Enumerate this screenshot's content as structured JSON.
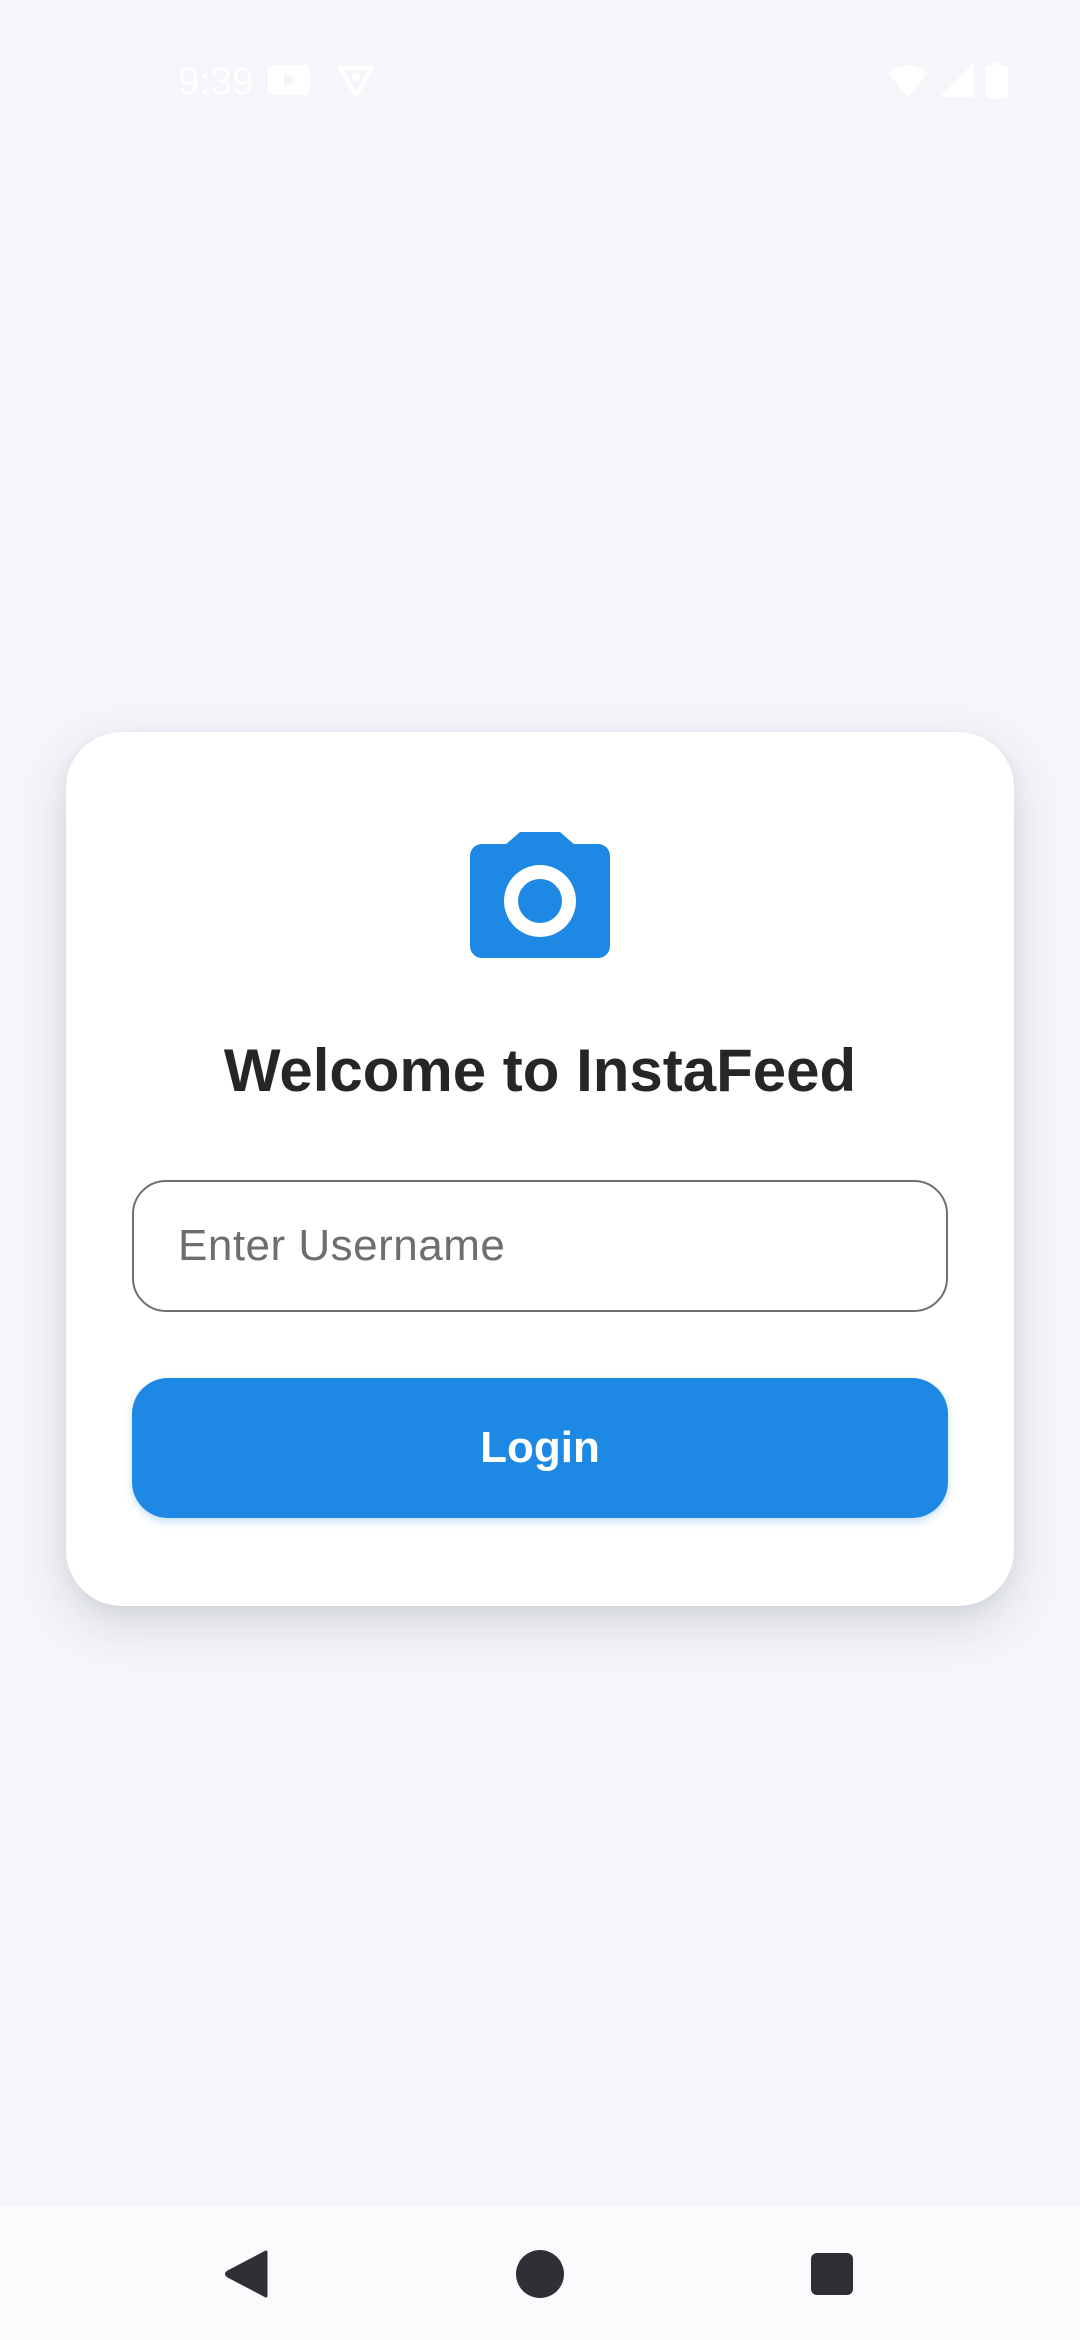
{
  "status_bar": {
    "time": "9:39",
    "left_icons": [
      "youtube-icon",
      "vpn-shield-icon"
    ],
    "right_icons": [
      "wifi-icon",
      "cellular-signal-icon",
      "battery-icon"
    ]
  },
  "login_card": {
    "logo_icon": "camera-icon",
    "title": "Welcome to InstaFeed",
    "username_placeholder": "Enter Username",
    "username_value": "",
    "login_label": "Login"
  },
  "navigation_bar": {
    "buttons": [
      "back-icon",
      "home-icon",
      "recents-icon"
    ]
  },
  "colors": {
    "accent": "#1e88e5",
    "background": "#f5f6fa",
    "card": "#ffffff",
    "title_text": "#262626"
  }
}
